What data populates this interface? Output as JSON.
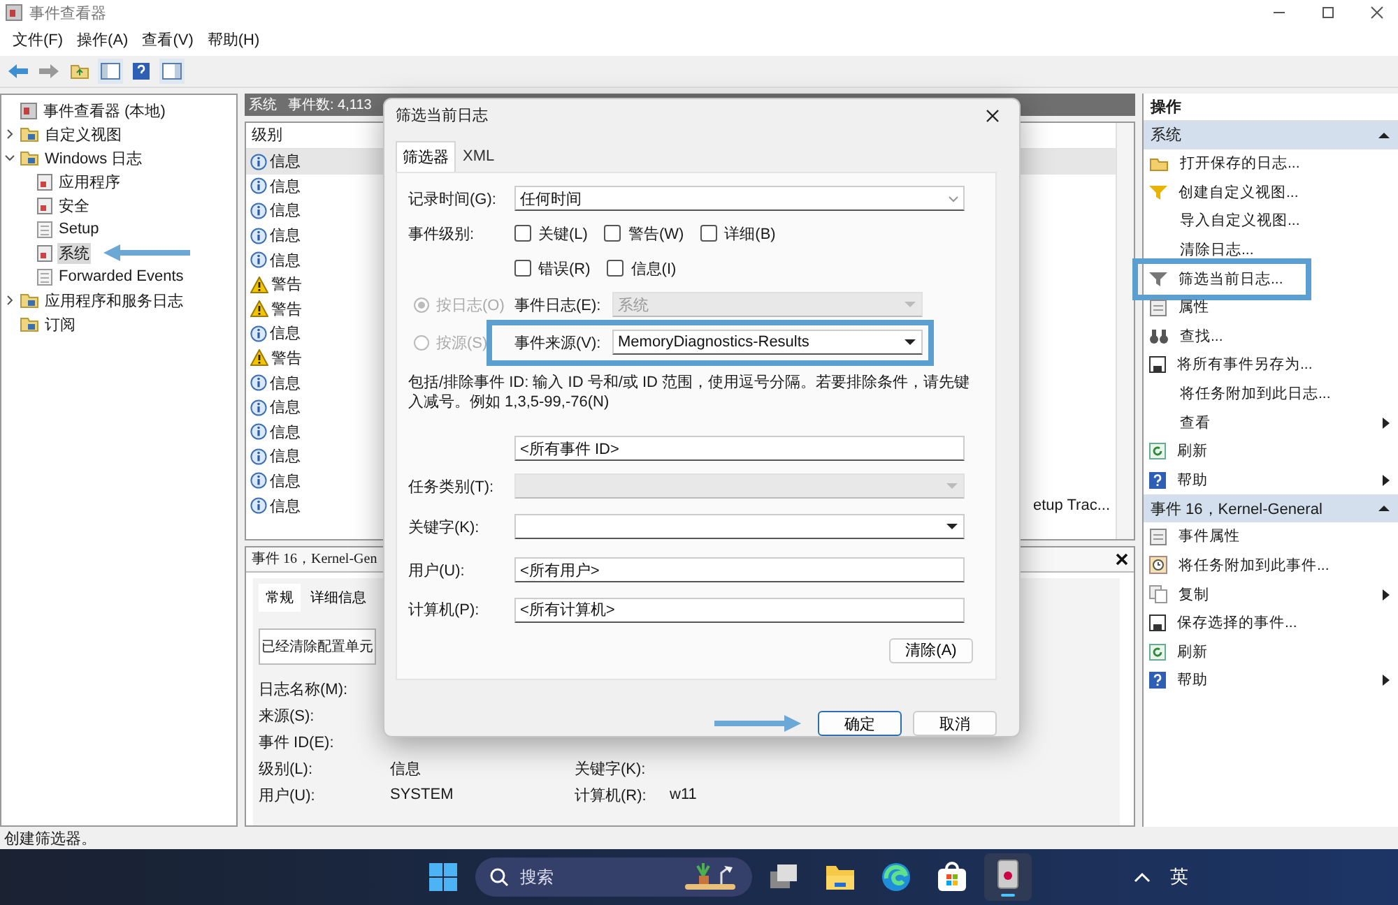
{
  "window": {
    "title": "事件查看器"
  },
  "menu": [
    "文件(F)",
    "操作(A)",
    "查看(V)",
    "帮助(H)"
  ],
  "tree": [
    {
      "label": "事件查看器 (本地)",
      "kind": "root",
      "selected": false,
      "children": [
        {
          "label": "自定义视图",
          "kind": "folder",
          "expanded": false,
          "selected": false
        },
        {
          "label": "Windows 日志",
          "kind": "folder",
          "expanded": true,
          "selected": false,
          "children": [
            {
              "label": "应用程序",
              "kind": "log",
              "selected": false
            },
            {
              "label": "安全",
              "kind": "log",
              "selected": false
            },
            {
              "label": "Setup",
              "kind": "plain",
              "selected": false
            },
            {
              "label": "系统",
              "kind": "log",
              "selected": true,
              "pointed": true
            },
            {
              "label": "Forwarded Events",
              "kind": "plain",
              "selected": false
            }
          ]
        },
        {
          "label": "应用程序和服务日志",
          "kind": "folder",
          "expanded": false,
          "selected": false
        },
        {
          "label": "订阅",
          "kind": "folder",
          "selected": false
        }
      ]
    }
  ],
  "log_header": {
    "name": "系统",
    "count": "事件数: 4,113"
  },
  "events": {
    "columns": [
      "级别"
    ],
    "rows": [
      {
        "level": "信息",
        "kind": "info",
        "selected": true
      },
      {
        "level": "信息",
        "kind": "info",
        "selected": false
      },
      {
        "level": "信息",
        "kind": "info",
        "selected": false
      },
      {
        "level": "信息",
        "kind": "info",
        "selected": false
      },
      {
        "level": "信息",
        "kind": "info",
        "selected": false
      },
      {
        "level": "警告",
        "kind": "warning",
        "selected": false
      },
      {
        "level": "警告",
        "kind": "warning",
        "selected": false
      },
      {
        "level": "信息",
        "kind": "info",
        "selected": false
      },
      {
        "level": "警告",
        "kind": "warning",
        "selected": false
      },
      {
        "level": "信息",
        "kind": "info",
        "selected": false
      },
      {
        "level": "信息",
        "kind": "info",
        "selected": false
      },
      {
        "level": "信息",
        "kind": "info",
        "selected": false
      },
      {
        "level": "信息",
        "kind": "info",
        "selected": false
      },
      {
        "level": "信息",
        "kind": "info",
        "selected": false
      },
      {
        "level": "信息",
        "kind": "info",
        "selected": false,
        "column_2": "etup Trac..."
      }
    ]
  },
  "detail": {
    "title": "事件 16，Kernel-Gen",
    "tabs": [
      {
        "label": "常规",
        "selected": true
      },
      {
        "label": "详细信息",
        "selected": false
      }
    ],
    "message": "已经清除配置单元",
    "rows": [
      {
        "label": "日志名称(M):"
      },
      {
        "label": "来源(S):"
      },
      {
        "label": "事件 ID(E):"
      },
      {
        "label": "级别(L):",
        "value": "信息",
        "label_2": "关键字(K):"
      },
      {
        "label": "用户(U):",
        "value": "SYSTEM",
        "label_2": "计算机(R):",
        "value_2": "w11"
      }
    ]
  },
  "actions": {
    "title": "操作",
    "sections": [
      {
        "title": "系统",
        "expanded": true,
        "items": [
          {
            "label": "打开保存的日志...",
            "kind": "open"
          },
          {
            "label": "创建自定义视图...",
            "kind": "filter"
          },
          {
            "label": "导入自定义视图...",
            "kind": "none"
          },
          {
            "label": "清除日志...",
            "kind": "none"
          },
          {
            "label": "筛选当前日志...",
            "kind": "filter-grey",
            "highlighted": true
          },
          {
            "label": "属性",
            "kind": "properties"
          },
          {
            "label": "查找...",
            "kind": "find"
          },
          {
            "label": "将所有事件另存为...",
            "kind": "save"
          },
          {
            "label": "将任务附加到此日志...",
            "kind": "none"
          },
          {
            "label": "查看",
            "kind": "none",
            "submenu": true
          },
          {
            "label": "刷新",
            "kind": "refresh"
          },
          {
            "label": "帮助",
            "kind": "help",
            "submenu": true
          }
        ]
      },
      {
        "title": "事件 16，Kernel-General",
        "expanded": true,
        "items": [
          {
            "label": "事件属性",
            "kind": "properties"
          },
          {
            "label": "将任务附加到此事件...",
            "kind": "task"
          },
          {
            "label": "复制",
            "kind": "copy",
            "submenu": true
          },
          {
            "label": "保存选择的事件...",
            "kind": "save"
          },
          {
            "label": "刷新",
            "kind": "refresh"
          },
          {
            "label": "帮助",
            "kind": "help",
            "submenu": true
          }
        ]
      }
    ]
  },
  "status_bar": "创建筛选器。",
  "dialog": {
    "title": "筛选当前日志",
    "tabs": [
      {
        "label": "筛选器",
        "selected": true
      },
      {
        "label": "XML",
        "selected": false
      }
    ],
    "logged": {
      "label": "记录时间(G):",
      "value": "任何时间"
    },
    "level": {
      "label": "事件级别:",
      "option_rows": [
        [
          {
            "label": "关键(L)",
            "checked": false
          },
          {
            "label": "警告(W)",
            "checked": false
          },
          {
            "label": "详细(B)",
            "checked": false
          }
        ],
        [
          {
            "label": "错误(R)",
            "checked": false
          },
          {
            "label": "信息(I)",
            "checked": false
          }
        ]
      ]
    },
    "scope": [
      {
        "label": "按日志(O)",
        "selected": true,
        "field_label": "事件日志(E):",
        "value": "系统",
        "disabled": true,
        "highlighted": false
      },
      {
        "label": "按源(S)",
        "selected": false,
        "field_label": "事件来源(V):",
        "value": "MemoryDiagnostics-Results",
        "disabled": false,
        "highlighted": true
      }
    ],
    "description": "包括/排除事件 ID: 输入 ID 号和/或 ID 范围，使用逗号分隔。若要排除条件，请先键入减号。例如 1,3,5-99,-76(N)",
    "event_id": "<所有事件 ID>",
    "fields": [
      {
        "label": "任务类别(T):",
        "kind": "dropdown",
        "disabled": true
      },
      {
        "label": "关键字(K):",
        "kind": "dropdown",
        "disabled": false
      },
      {
        "label": "用户(U):",
        "kind": "text",
        "value": "<所有用户>"
      },
      {
        "label": "计算机(P):",
        "kind": "text",
        "value": "<所有计算机>"
      }
    ],
    "clear_button": "清除(A)",
    "buttons": [
      {
        "label": "确定",
        "default": true,
        "pointed": true
      },
      {
        "label": "取消",
        "default": false,
        "pointed": false
      }
    ]
  },
  "taskbar": {
    "search": "搜索",
    "apps": [
      {
        "kind": "task-view",
        "selected": false
      },
      {
        "kind": "folder",
        "selected": false
      },
      {
        "kind": "browser",
        "selected": false
      },
      {
        "kind": "store",
        "selected": false
      },
      {
        "kind": "event-viewer",
        "selected": true
      }
    ],
    "ime": "英"
  }
}
